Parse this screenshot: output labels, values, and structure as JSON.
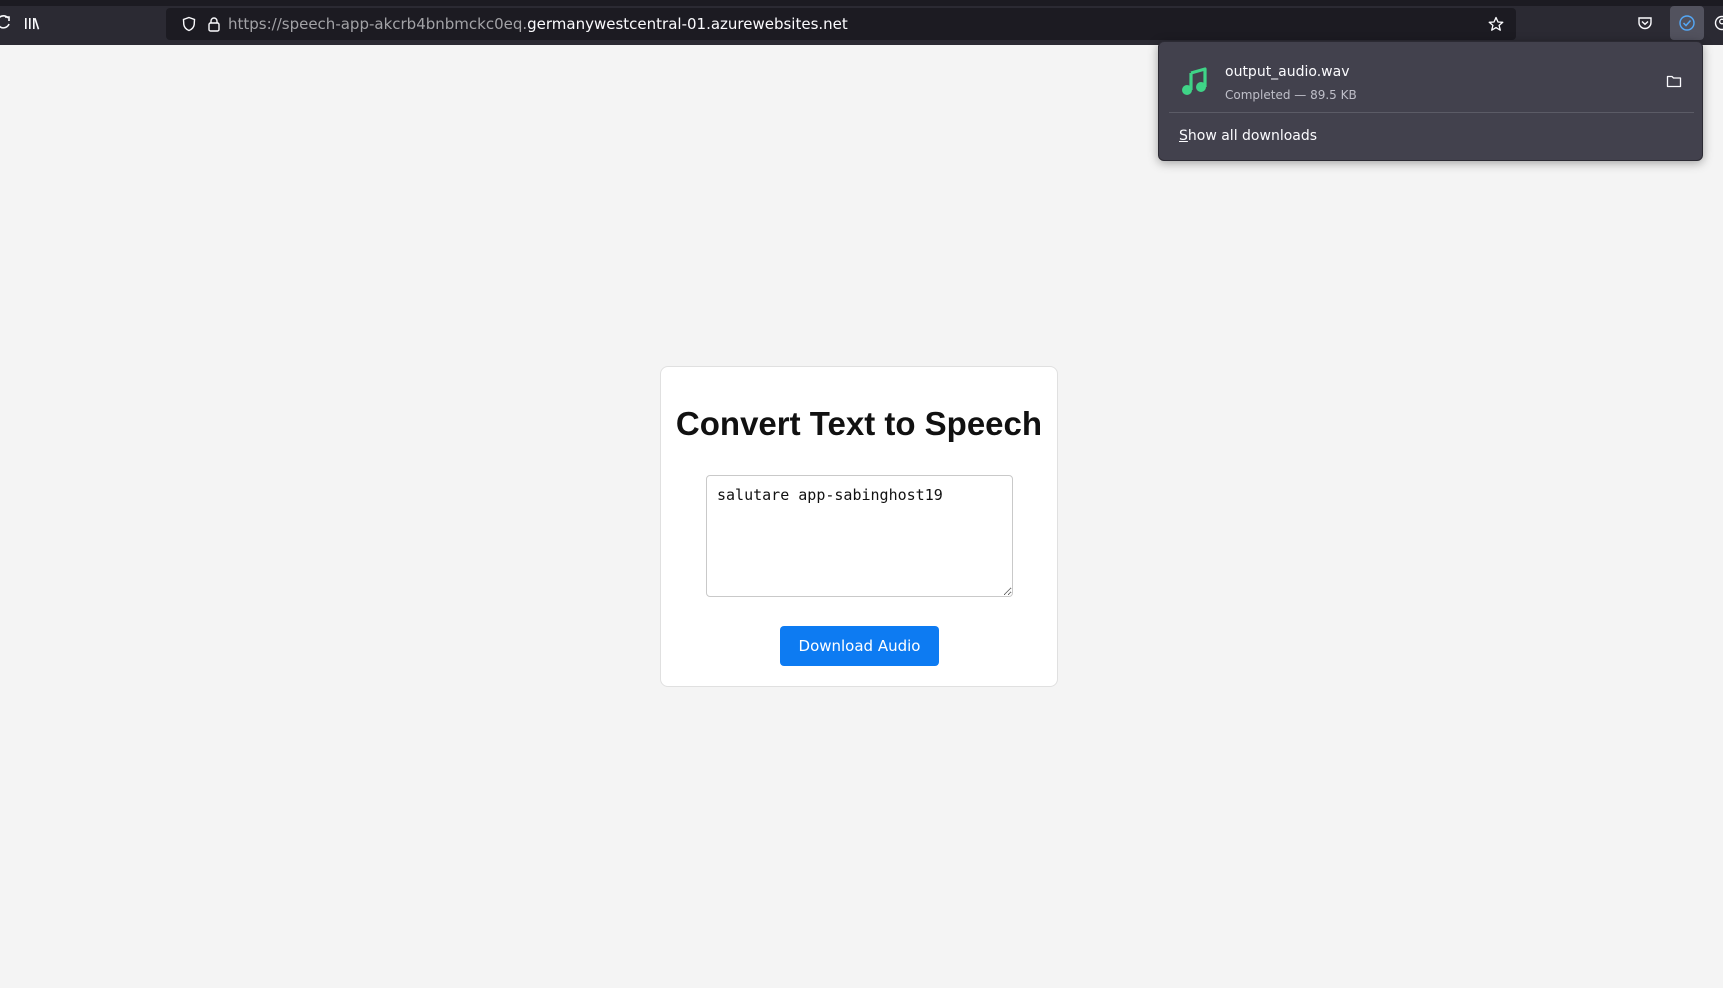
{
  "browser": {
    "url_prefix": "https://speech-app-akcrb4bnbmckc0eq.",
    "url_domain": "germanywestcentral-01.azurewebsites.net",
    "icons": {
      "library": "library-icon",
      "shield": "tracking-protection-icon",
      "lock": "lock-icon",
      "bookmark": "star-icon",
      "pocket": "pocket-icon",
      "downloads": "downloads-icon",
      "account": "account-icon"
    }
  },
  "downloads_panel": {
    "items": [
      {
        "filename": "output_audio.wav",
        "status": "Completed — 89.5 KB",
        "icon": "music-file-icon"
      }
    ],
    "show_all_access_key": "S",
    "show_all_rest": "how all downloads"
  },
  "page": {
    "title": "Convert Text to Speech",
    "textarea_value": "salutare app-sabinghost19",
    "button_label": "Download Audio",
    "accent_color": "#0d7bf2"
  }
}
